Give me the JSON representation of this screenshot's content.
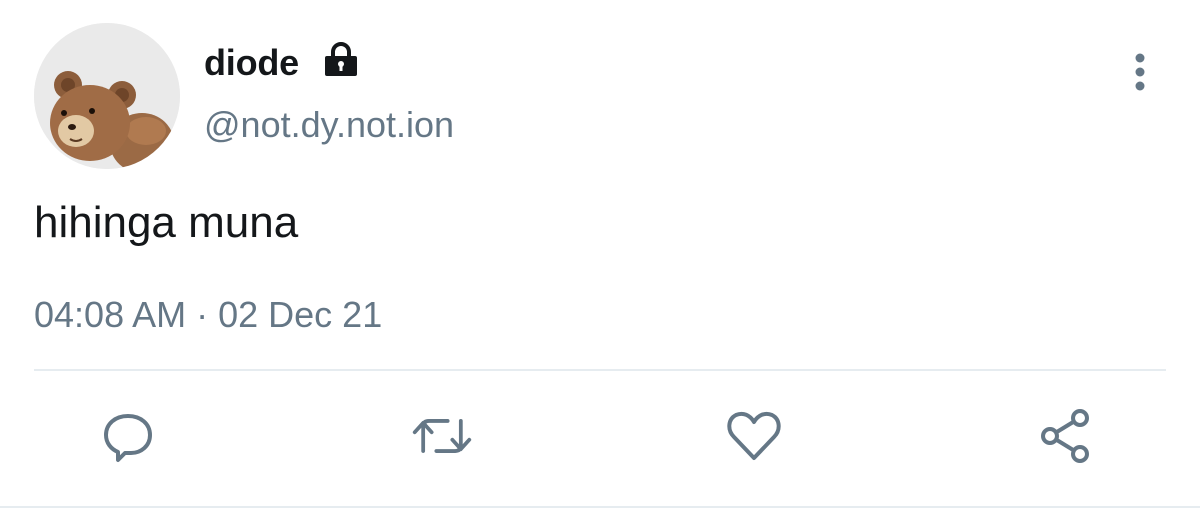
{
  "user": {
    "display_name": "diode",
    "handle": "@not.dy.not.ion",
    "avatar_icon": "teddy-bear-avatar",
    "protected_icon": "lock-icon"
  },
  "tweet": {
    "text": "hihinga muna",
    "time": "04:08 AM",
    "separator": "·",
    "date": "02 Dec 21"
  },
  "actions": [
    {
      "name": "reply",
      "icon": "reply-icon"
    },
    {
      "name": "retweet",
      "icon": "retweet-icon"
    },
    {
      "name": "like",
      "icon": "heart-icon"
    },
    {
      "name": "share",
      "icon": "share-icon"
    }
  ],
  "colors": {
    "text_primary": "#14171a",
    "text_secondary": "#657786",
    "icon": "#657786",
    "divider": "#e6ecf0"
  }
}
